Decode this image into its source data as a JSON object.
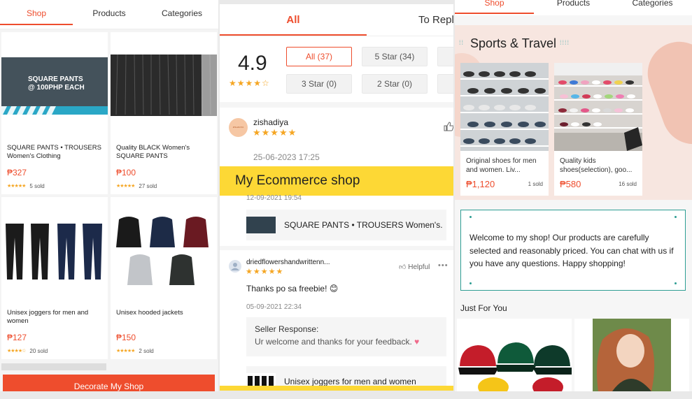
{
  "panel1": {
    "tabs": [
      "Shop",
      "Products",
      "Categories"
    ],
    "banner_text_line1": "SQUARE PANTS",
    "banner_text_line2": "@ 100PHP EACH",
    "products": [
      {
        "name": "SQUARE PANTS • TROUSERS Women's Clothing",
        "price": "₱327",
        "stars": "★★★★★",
        "sold": "5 sold"
      },
      {
        "name": "Quality BLACK Women's SQUARE PANTS",
        "price": "₱100",
        "stars": "★★★★★",
        "sold": "27 sold"
      },
      {
        "name": "Unisex joggers for men and women",
        "price": "₱127",
        "stars": "★★★★☆",
        "sold": "20 sold"
      },
      {
        "name": "Unisex hooded jackets",
        "price": "₱150",
        "stars": "★★★★★",
        "sold": "2 sold"
      }
    ],
    "decorate_button": "Decorate My Shop"
  },
  "panel2": {
    "tabs": [
      "All",
      "To Repl"
    ],
    "rating": "4.9",
    "rating_stars": "★★★★☆",
    "filters": [
      "All (37)",
      "5 Star (34)",
      "3 Star (0)",
      "2 Star (0)"
    ],
    "review1": {
      "user": "zishadiya",
      "stars": "★★★★★",
      "date": "25-06-2023 17:25",
      "avatar_text": "ZISHADIYA"
    },
    "banner": "My Ecommerce shop",
    "review1_product_date": "12-09-2021 19:54",
    "review1_product": "SQUARE PANTS • TROUSERS Women's...",
    "review2": {
      "user": "driedflowershandwrittenn...",
      "stars": "★★★★★",
      "helpful": "Helpful",
      "comment": "Thanks po sa freebie! 😊",
      "date": "05-09-2021 22:34"
    },
    "seller_response": {
      "heading": "Seller Response:",
      "body": "Ur welcome and thanks for your feedback."
    },
    "review2_product": "Unisex joggers for men and women"
  },
  "panel3": {
    "tabs": [
      "Shop",
      "Products",
      "Categories"
    ],
    "section_title": "Sports & Travel",
    "products": [
      {
        "name": "Original shoes for men and women. Liv...",
        "price": "₱1,120",
        "sold": "1 sold"
      },
      {
        "name": "Quality kids shoes(selection), goo...",
        "price": "₱580",
        "sold": "16 sold"
      }
    ],
    "welcome": "Welcome to my shop! Our products are carefully selected and reasonably priced. You can chat with us if you have any questions. Happy shopping!",
    "just_for_you": "Just For You"
  },
  "colors": {
    "accent": "#ee4d2d",
    "star": "#f5a623",
    "banner_yellow": "#fdd835",
    "teal": "#2e9e93"
  }
}
